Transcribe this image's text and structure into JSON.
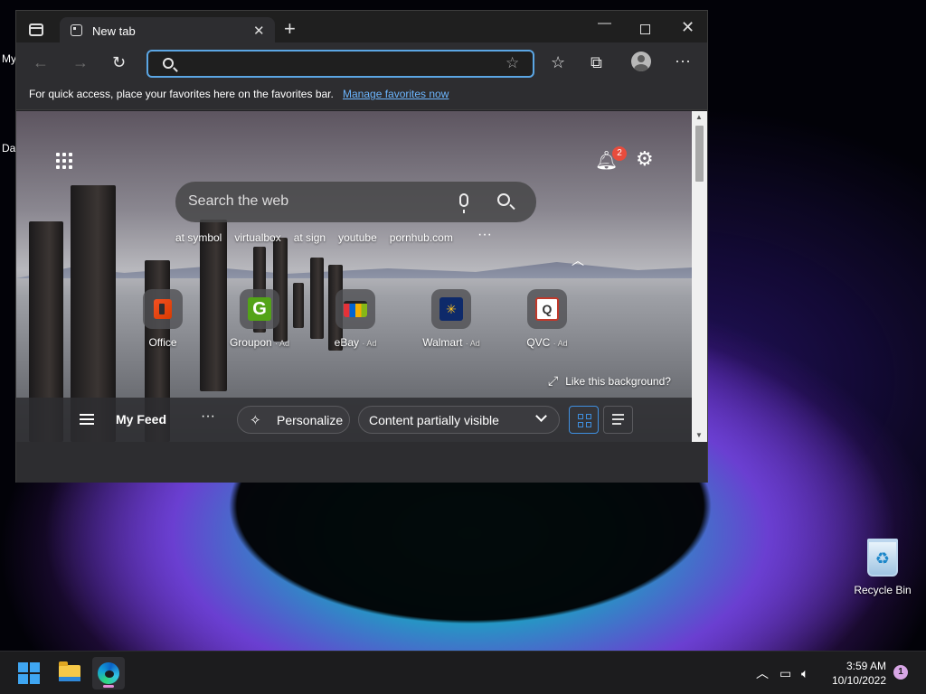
{
  "desktop": {
    "edge_text_1": "My",
    "edge_text_2": "Da",
    "recycle_bin_label": "Recycle Bin"
  },
  "browser": {
    "tab_title": "New tab",
    "address_placeholder": "",
    "favbar": {
      "text": "For quick access, place your favorites here on the favorites bar.",
      "link": "Manage favorites now"
    }
  },
  "newtab": {
    "notification_count": "2",
    "search_placeholder": "Search the web",
    "suggestions": [
      "at symbol",
      "virtualbox",
      "at sign",
      "youtube",
      "pornhub.com"
    ],
    "tiles": [
      {
        "name": "Office",
        "ad": ""
      },
      {
        "name": "Groupon",
        "ad": "· Ad"
      },
      {
        "name": "eBay",
        "ad": "· Ad"
      },
      {
        "name": "Walmart",
        "ad": "· Ad"
      },
      {
        "name": "QVC",
        "ad": "· Ad"
      }
    ],
    "like_background": "Like this background?",
    "feed": {
      "title": "My Feed",
      "personalize": "Personalize",
      "content_filter": "Content partially visible"
    }
  },
  "taskbar": {
    "time": "3:59 AM",
    "date": "10/10/2022",
    "notification_count": "1"
  },
  "colors": {
    "accent": "#3f8fe0",
    "link": "#6cb6ff",
    "badge": "#e84c3d"
  }
}
